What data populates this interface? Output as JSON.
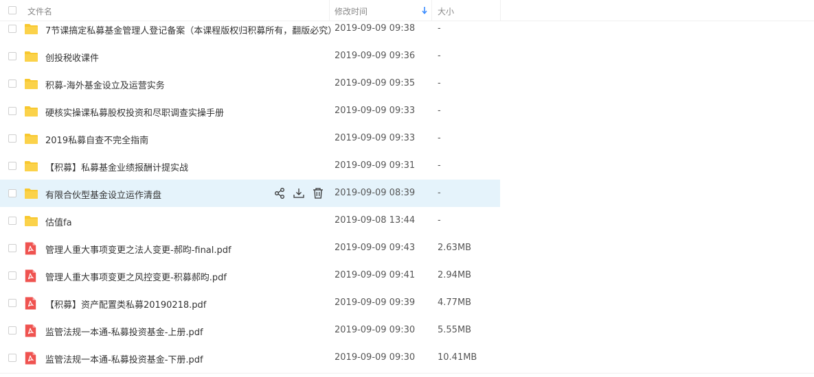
{
  "header": {
    "name_label": "文件名",
    "time_label": "修改时间",
    "size_label": "大小",
    "sort_icon": "arrow-down-icon"
  },
  "colors": {
    "folder": "#f8c82f",
    "pdf": "#ef5350",
    "hover_row": "#e5f3fb",
    "sort_accent": "#3b8cff"
  },
  "files": [
    {
      "name": "7节课搞定私募基金管理人登记备案（本课程版权归积募所有，翻版必究）",
      "time": "2019-09-09 09:38",
      "size": "-",
      "type": "folder-icon"
    },
    {
      "name": "创投税收课件",
      "time": "2019-09-09 09:36",
      "size": "-",
      "type": "folder-icon"
    },
    {
      "name": "积募-海外基金设立及运营实务",
      "time": "2019-09-09 09:35",
      "size": "-",
      "type": "folder-icon"
    },
    {
      "name": "硬核实操课私募股权投资和尽职调查实操手册",
      "time": "2019-09-09 09:33",
      "size": "-",
      "type": "folder-icon"
    },
    {
      "name": "2019私募自查不完全指南",
      "time": "2019-09-09 09:33",
      "size": "-",
      "type": "folder-icon"
    },
    {
      "name": "【积募】私募基金业绩报酬计提实战",
      "time": "2019-09-09 09:31",
      "size": "-",
      "type": "folder-icon"
    },
    {
      "name": "有限合伙型基金设立运作清盘",
      "time": "2019-09-09 08:39",
      "size": "-",
      "type": "folder-icon"
    },
    {
      "name": "估值fa",
      "time": "2019-09-08 13:44",
      "size": "-",
      "type": "folder-icon"
    },
    {
      "name": "管理人重大事项变更之法人变更-郝昀-final.pdf",
      "time": "2019-09-09 09:43",
      "size": "2.63MB",
      "type": "pdf-icon"
    },
    {
      "name": "管理人重大事项变更之风控变更-积募郝昀.pdf",
      "time": "2019-09-09 09:41",
      "size": "2.94MB",
      "type": "pdf-icon"
    },
    {
      "name": "【积募】资产配置类私募20190218.pdf",
      "time": "2019-09-09 09:39",
      "size": "4.77MB",
      "type": "pdf-icon"
    },
    {
      "name": "监管法规一本通-私募投资基金-上册.pdf",
      "time": "2019-09-09 09:30",
      "size": "5.55MB",
      "type": "pdf-icon"
    },
    {
      "name": "监管法规一本通-私募投资基金-下册.pdf",
      "time": "2019-09-09 09:30",
      "size": "10.41MB",
      "type": "pdf-icon"
    }
  ],
  "row_actions": [
    "share-icon",
    "download-icon",
    "delete-icon"
  ]
}
